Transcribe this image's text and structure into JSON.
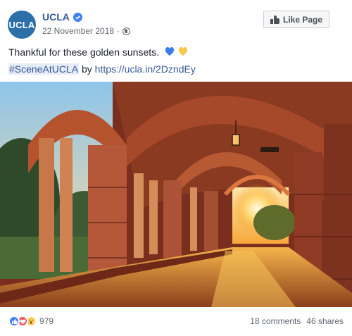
{
  "header": {
    "avatar_text": "UCLA",
    "page_name": "UCLA",
    "date": "22 November 2018",
    "separator": "·",
    "like_page_label": "Like Page"
  },
  "post": {
    "caption": "Thankful for these golden sunsets.",
    "hashtag": "#SceneAtUCLA",
    "by_word": "by",
    "link": "https://ucla.in/2DzndEy"
  },
  "footer": {
    "reaction_count": "979",
    "comments": "18 comments",
    "shares": "46 shares"
  },
  "colors": {
    "brand_blue": "#365899",
    "avatar_blue": "#2d6fa8",
    "reaction_like": "#4080ff",
    "reaction_love": "#f25268",
    "reaction_wow": "#fcd05a"
  },
  "icons": [
    "verified-badge-icon",
    "globe-icon",
    "thumbs-up-icon",
    "blue-heart-emoji",
    "yellow-heart-emoji",
    "like-reaction-icon",
    "love-reaction-icon",
    "wow-reaction-icon"
  ]
}
